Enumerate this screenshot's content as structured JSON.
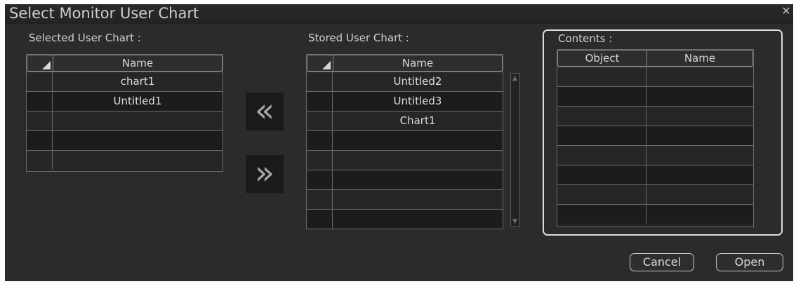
{
  "dialog": {
    "title": "Select Monitor User Chart",
    "close_icon": "close-x"
  },
  "selected": {
    "label": "Selected User Chart :",
    "column": "Name",
    "rows": [
      "chart1",
      "Untitled1",
      "",
      "",
      ""
    ]
  },
  "stored": {
    "label": "Stored User Chart :",
    "column": "Name",
    "rows": [
      "Untitled2",
      "Untitled3",
      "Chart1",
      "",
      "",
      "",
      "",
      ""
    ]
  },
  "transfer": {
    "add_glyph": "«",
    "remove_glyph": "»"
  },
  "contents": {
    "label": "Contents :",
    "col_object": "Object",
    "col_name": "Name",
    "rows": [
      [
        "",
        ""
      ],
      [
        "",
        ""
      ],
      [
        "",
        ""
      ],
      [
        "",
        ""
      ],
      [
        "",
        ""
      ],
      [
        "",
        ""
      ],
      [
        "",
        ""
      ],
      [
        "",
        ""
      ]
    ]
  },
  "buttons": {
    "cancel": "Cancel",
    "open": "Open"
  }
}
